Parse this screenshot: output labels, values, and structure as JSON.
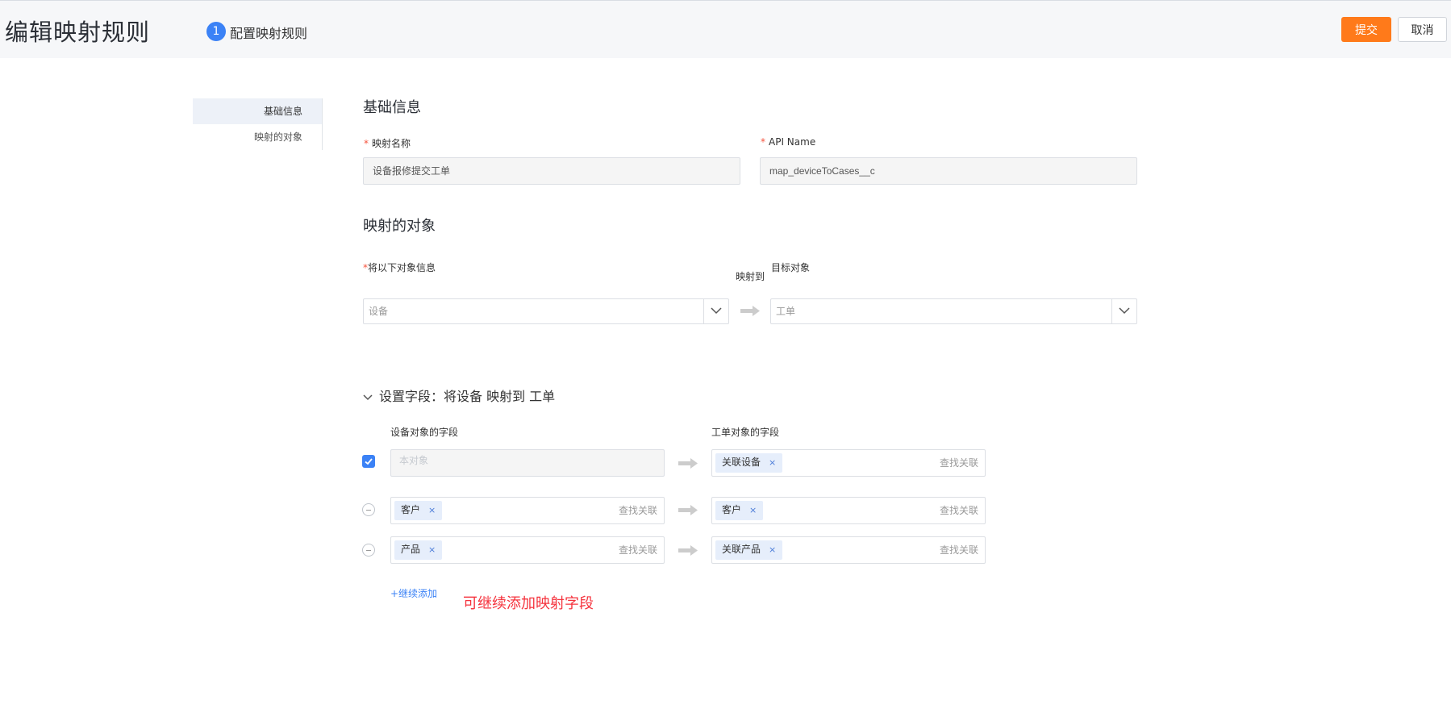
{
  "header": {
    "title": "编辑映射规则",
    "step_number": "1",
    "step_label": "配置映射规则",
    "submit_label": "提交",
    "cancel_label": "取消",
    "accent_color": "#ff7a1a"
  },
  "side_nav": {
    "items": [
      {
        "label": "基础信息",
        "active": true
      },
      {
        "label": "映射的对象",
        "active": false
      }
    ]
  },
  "basic_info": {
    "title": "基础信息",
    "mapping_name_label": "映射名称",
    "mapping_name_value": "设备报修提交工单",
    "api_name_label": "API Name",
    "api_name_value": "map_deviceToCases__c"
  },
  "mapped_object": {
    "title": "映射的对象",
    "source_label": "将以下对象信息",
    "maps_to": "映射到",
    "target_label": "目标对象",
    "source_value": "设备",
    "target_value": "工单"
  },
  "field_settings": {
    "title": "设置字段：将设备 映射到 工单",
    "source_col": "设备对象的字段",
    "target_col": "工单对象的字段",
    "lookup_label": "查找关联",
    "rows": [
      {
        "checked": true,
        "source": "",
        "source_placeholder": "本对象",
        "target": "关联设备"
      },
      {
        "checked": false,
        "source": "客户",
        "target": "客户"
      },
      {
        "checked": false,
        "source": "产品",
        "target": "关联产品"
      }
    ],
    "add_more": "+继续添加",
    "annotation": "可继续添加映射字段"
  }
}
